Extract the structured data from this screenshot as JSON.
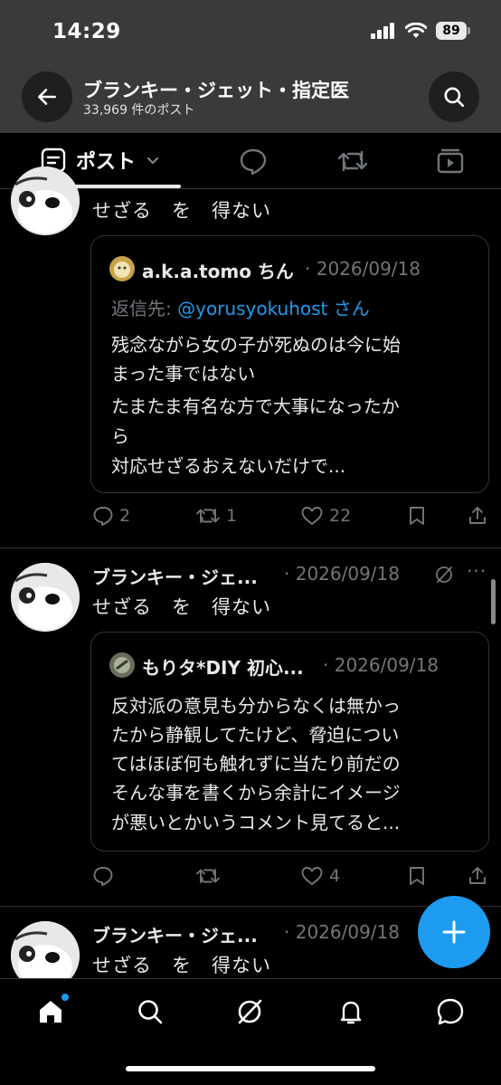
{
  "status_bar": {
    "time": "14:29",
    "battery": "89"
  },
  "header": {
    "title": "ブランキー・ジェット・指定医",
    "subtitle": "33,969 件のポスト"
  },
  "tabs": {
    "posts_label": "ポスト"
  },
  "posts": [
    {
      "body": "せざる　を　得ない",
      "quote": {
        "name": "a.k.a.tomo ちん",
        "date": "· 2026/09/18",
        "reply_prefix": "返信先: ",
        "reply_mention": "@yorusyokuhost さん",
        "lines": [
          "残念ながら女の子が死ぬのは今に始",
          "まった事ではない",
          "たまたま有名な方で大事になったか",
          "ら",
          "対応せざるおえないだけで..."
        ]
      },
      "actions": {
        "replies": "2",
        "reposts": "1",
        "likes": "22"
      }
    },
    {
      "name": "ブランキー・ジェ...",
      "date": "· 2026/09/18",
      "body": "せざる　を　得ない",
      "quote": {
        "name": "もりタ*DIY 初心...",
        "date": "· 2026/09/18",
        "lines": [
          "反対派の意見も分からなくは無かっ",
          "たから静観してたけど、脅迫につい",
          "てはほぼ何も触れずに当たり前だの",
          "そんな事を書くから余計にイメージ",
          "が悪いとかいうコメント見てると..."
        ]
      },
      "actions": {
        "replies": "",
        "reposts": "",
        "likes": "4"
      }
    },
    {
      "name": "ブランキー・ジェ...",
      "date": "· 2026/09/18",
      "body": "せざる　を　得ない"
    }
  ],
  "colors": {
    "accent": "#1d9bf0",
    "muted": "#71767b",
    "background": "#000000"
  }
}
